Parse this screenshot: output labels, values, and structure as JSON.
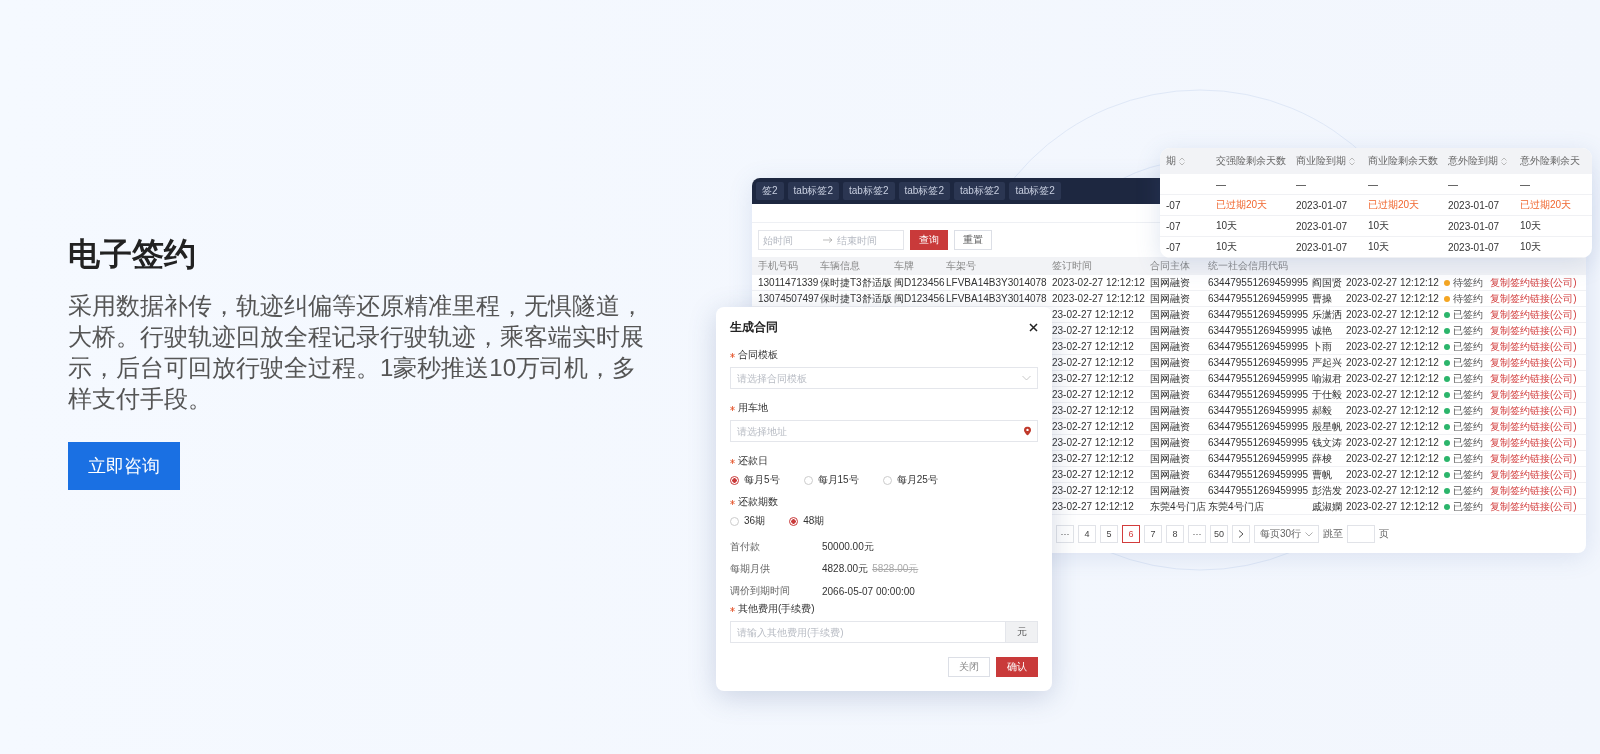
{
  "hero": {
    "title": "电子签约",
    "text": "采用数据补传，轨迹纠偏等还原精准里程，无惧隧道，大桥。行驶轨迹回放全程记录行驶轨迹，乘客端实时展示，后台可回放行驶全过程。1豪秒推送10万司机，多样支付手段。",
    "cta": "立即咨询"
  },
  "table_window": {
    "tabs": [
      "签2",
      "tab标签2",
      "tab标签2",
      "tab标签2",
      "tab标签2",
      "tab标签2"
    ],
    "filter": {
      "start_placeholder": "始时间",
      "end_placeholder": "结束时间",
      "search": "查询",
      "reset": "重置"
    },
    "columns": [
      "手机号码",
      "车辆信息",
      "车牌",
      "车架号",
      "签订时间",
      "合同主体",
      "统一社会信用代码"
    ],
    "rows": [
      {
        "cells": [
          "13011471339",
          "保时捷T3舒适版",
          "闽D123456",
          "LFVBA14B3Y3014078",
          "2023-02-27 12:12:12",
          "国网融资",
          "634479551269459995",
          "阎国贤",
          "2023-02-27 12:12:12"
        ],
        "status": {
          "text": "待签约",
          "color": "#f5a623"
        },
        "action": "复制签约链接(公司)"
      },
      {
        "cells": [
          "13074507497",
          "保时捷T3舒适版",
          "闽D123456",
          "LFVBA14B3Y3014078",
          "2023-02-27 12:12:12",
          "国网融资",
          "634479551269459995",
          "曹操",
          "2023-02-27 12:12:12"
        ],
        "status": {
          "text": "待签约",
          "color": "#f5a623"
        },
        "action": "复制签约链接(公司)"
      },
      {
        "cells": [
          "23-02-27 12:12:12",
          "国网融资",
          "634479551269459995",
          "乐潇洒",
          "2023-02-27 12:12:12"
        ],
        "status": {
          "text": "已签约",
          "color": "#2bb56b"
        },
        "action": "复制签约链接(公司)"
      },
      {
        "cells": [
          "23-02-27 12:12:12",
          "国网融资",
          "634479551269459995",
          "诚艳",
          "2023-02-27 12:12:12"
        ],
        "status": {
          "text": "已签约",
          "color": "#2bb56b"
        },
        "action": "复制签约链接(公司)"
      },
      {
        "cells": [
          "23-02-27 12:12:12",
          "国网融资",
          "634479551269459995",
          "卜雨",
          "2023-02-27 12:12:12"
        ],
        "status": {
          "text": "已签约",
          "color": "#2bb56b"
        },
        "action": "复制签约链接(公司)"
      },
      {
        "cells": [
          "23-02-27 12:12:12",
          "国网融资",
          "634479551269459995",
          "严起兴",
          "2023-02-27 12:12:12"
        ],
        "status": {
          "text": "已签约",
          "color": "#2bb56b"
        },
        "action": "复制签约链接(公司)"
      },
      {
        "cells": [
          "23-02-27 12:12:12",
          "国网融资",
          "634479551269459995",
          "喻淑君",
          "2023-02-27 12:12:12"
        ],
        "status": {
          "text": "已签约",
          "color": "#2bb56b"
        },
        "action": "复制签约链接(公司)"
      },
      {
        "cells": [
          "23-02-27 12:12:12",
          "国网融资",
          "634479551269459995",
          "于仕毅",
          "2023-02-27 12:12:12"
        ],
        "status": {
          "text": "已签约",
          "color": "#2bb56b"
        },
        "action": "复制签约链接(公司)"
      },
      {
        "cells": [
          "23-02-27 12:12:12",
          "国网融资",
          "634479551269459995",
          "郝毅",
          "2023-02-27 12:12:12"
        ],
        "status": {
          "text": "已签约",
          "color": "#2bb56b"
        },
        "action": "复制签约链接(公司)"
      },
      {
        "cells": [
          "23-02-27 12:12:12",
          "国网融资",
          "634479551269459995",
          "殷星帆",
          "2023-02-27 12:12:12"
        ],
        "status": {
          "text": "已签约",
          "color": "#2bb56b"
        },
        "action": "复制签约链接(公司)"
      },
      {
        "cells": [
          "23-02-27 12:12:12",
          "国网融资",
          "634479551269459995",
          "钱文涛",
          "2023-02-27 12:12:12"
        ],
        "status": {
          "text": "已签约",
          "color": "#2bb56b"
        },
        "action": "复制签约链接(公司)"
      },
      {
        "cells": [
          "23-02-27 12:12:12",
          "国网融资",
          "634479551269459995",
          "薛梭",
          "2023-02-27 12:12:12"
        ],
        "status": {
          "text": "已签约",
          "color": "#2bb56b"
        },
        "action": "复制签约链接(公司)"
      },
      {
        "cells": [
          "23-02-27 12:12:12",
          "国网融资",
          "634479551269459995",
          "曹帆",
          "2023-02-27 12:12:12"
        ],
        "status": {
          "text": "已签约",
          "color": "#2bb56b"
        },
        "action": "复制签约链接(公司)"
      },
      {
        "cells": [
          "23-02-27 12:12:12",
          "国网融资",
          "634479551269459995",
          "彭浩发",
          "2023-02-27 12:12:12"
        ],
        "status": {
          "text": "已签约",
          "color": "#2bb56b"
        },
        "action": "复制签约链接(公司)"
      },
      {
        "cells": [
          "23-02-27 12:12:12",
          "东莞4号门店",
          "东莞4号门店",
          "戚淑嫻",
          "2023-02-27 12:12:12"
        ],
        "status": {
          "text": "已签约",
          "color": "#2bb56b"
        },
        "action": "复制签约链接(公司)"
      }
    ],
    "pagination": {
      "pages": [
        {
          "label": "···",
          "selected": false
        },
        {
          "label": "4",
          "selected": false
        },
        {
          "label": "5",
          "selected": false
        },
        {
          "label": "6",
          "selected": true
        },
        {
          "label": "7",
          "selected": false
        },
        {
          "label": "8",
          "selected": false
        },
        {
          "label": "···",
          "selected": false
        },
        {
          "label": "50",
          "selected": false
        }
      ],
      "page_size": "每页30行",
      "jump_label": "跳至",
      "jump_suffix": "页"
    }
  },
  "insurance_card": {
    "columns": [
      {
        "label": "期",
        "sortable": true
      },
      {
        "label": "交强险剩余天数",
        "sortable": false
      },
      {
        "label": "商业险到期",
        "sortable": true
      },
      {
        "label": "商业险剩余天数",
        "sortable": false
      },
      {
        "label": "意外险到期",
        "sortable": true
      },
      {
        "label": "意外险剩余天",
        "sortable": false
      }
    ],
    "rows": [
      [
        "",
        "—",
        "—",
        "—",
        "—",
        "—"
      ],
      [
        "-07",
        {
          "text": "已过期20天",
          "kind": "overdue"
        },
        "2023-01-07",
        {
          "text": "已过期20天",
          "kind": "overdue"
        },
        "2023-01-07",
        {
          "text": "已过期20天",
          "kind": "overdue"
        }
      ],
      [
        "-07",
        "10天",
        "2023-01-07",
        "10天",
        "2023-01-07",
        "10天"
      ],
      [
        "-07",
        "10天",
        "2023-01-07",
        "10天",
        "2023-01-07",
        "10天"
      ]
    ]
  },
  "modal": {
    "title": "生成合同",
    "fields": [
      {
        "kind": "select",
        "label": "合同模板",
        "required": true,
        "placeholder": "请选择合同模板"
      },
      {
        "kind": "location",
        "label": "用车地",
        "required": true,
        "placeholder": "请选择地址"
      },
      {
        "kind": "radio",
        "label": "还款日",
        "required": true,
        "options": [
          {
            "label": "每月5号",
            "selected": true
          },
          {
            "label": "每月15号",
            "selected": false
          },
          {
            "label": "每月25号",
            "selected": false
          }
        ]
      },
      {
        "kind": "radio",
        "label": "还款期数",
        "required": true,
        "options": [
          {
            "label": "36期",
            "selected": false
          },
          {
            "label": "48期",
            "selected": true
          }
        ]
      },
      {
        "kind": "info",
        "label": "首付款",
        "value": "50000.00元"
      },
      {
        "kind": "info",
        "label": "每期月供",
        "value": "4828.00元",
        "old_value": "5828.00元"
      },
      {
        "kind": "info",
        "label": "调价到期时间",
        "value": "2066-05-07 00:00:00"
      },
      {
        "kind": "addon",
        "label": "其他费用(手续费)",
        "required": true,
        "placeholder": "请输入其他费用(手续费)",
        "addon": "元"
      }
    ],
    "buttons": [
      {
        "label": "关闭",
        "kind": "default"
      },
      {
        "label": "确认",
        "kind": "primary"
      }
    ]
  }
}
